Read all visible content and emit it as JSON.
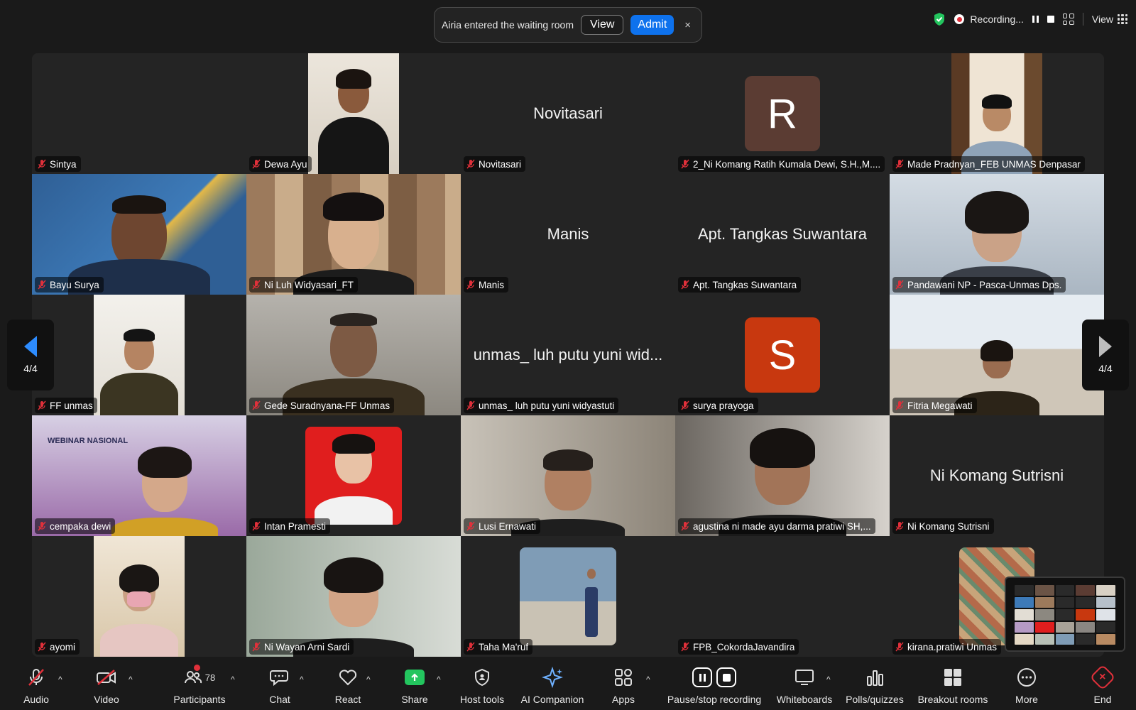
{
  "notification": {
    "message": "Airia entered the waiting room",
    "view_label": "View",
    "admit_label": "Admit",
    "close_symbol": "×"
  },
  "top_right": {
    "recording_label": "Recording...",
    "view_label": "View",
    "colors": {
      "shield": "#23c55e",
      "record_dot": "#e0303a"
    }
  },
  "pagination": {
    "current": "4/4"
  },
  "tiles": [
    {
      "name": "Sintya",
      "muted": true,
      "type": "empty"
    },
    {
      "name": "Dewa Ayu",
      "muted": true,
      "type": "video"
    },
    {
      "name": "Novitasari",
      "display_name": "Novitasari",
      "muted": true,
      "type": "name"
    },
    {
      "name": "2_Ni Komang Ratih Kumala Dewi, S.H.,M....",
      "muted": true,
      "type": "avatar",
      "initial": "R",
      "avatar_color": "#5b3c33"
    },
    {
      "name": "Made Pradnyan_FEB UNMAS Denpasar",
      "muted": true,
      "type": "video"
    },
    {
      "name": "Bayu Surya",
      "muted": true,
      "type": "video"
    },
    {
      "name": "Ni Luh Widyasari_FT",
      "muted": true,
      "type": "video"
    },
    {
      "name": "Manis",
      "display_name": "Manis",
      "muted": true,
      "type": "name"
    },
    {
      "name": "Apt. Tangkas Suwantara",
      "display_name": "Apt. Tangkas Suwantara",
      "muted": true,
      "type": "name"
    },
    {
      "name": "Pandawani NP - Pasca-Unmas Dps.",
      "muted": true,
      "type": "video"
    },
    {
      "name": "FF unmas",
      "muted": true,
      "type": "video"
    },
    {
      "name": "Gede Suradnyana-FF Unmas",
      "muted": true,
      "type": "video"
    },
    {
      "name": "unmas_ luh putu yuni widyastuti",
      "display_name": "unmas_ luh putu yuni wid...",
      "muted": true,
      "type": "name"
    },
    {
      "name": "surya prayoga",
      "muted": true,
      "type": "avatar",
      "initial": "S",
      "avatar_color": "#c8380f"
    },
    {
      "name": "Fitria Megawati",
      "muted": true,
      "type": "video"
    },
    {
      "name": "cempaka dewi",
      "muted": true,
      "type": "video",
      "banner_title": "WEBINAR NASIONAL"
    },
    {
      "name": "Intan Pramesti",
      "muted": true,
      "type": "video"
    },
    {
      "name": "Lusi Ernawati",
      "muted": true,
      "type": "video"
    },
    {
      "name": "agustina ni made ayu darma pratiwi SH,...",
      "muted": true,
      "type": "video"
    },
    {
      "name": "Ni Komang Sutrisni",
      "display_name": "Ni Komang Sutrisni",
      "muted": true,
      "type": "name"
    },
    {
      "name": "ayomi",
      "muted": true,
      "type": "video"
    },
    {
      "name": "Ni Wayan Arni Sardi",
      "muted": true,
      "type": "video"
    },
    {
      "name": "Taha Ma'ruf",
      "muted": true,
      "type": "video"
    },
    {
      "name": "FPB_CokordaJavandira",
      "muted": true,
      "type": "empty"
    },
    {
      "name": "kirana.pratiwi Unmas",
      "muted": true,
      "type": "video"
    }
  ],
  "toolbar": {
    "audio": "Audio",
    "video": "Video",
    "participants": "Participants",
    "participants_count": "78",
    "chat": "Chat",
    "react": "React",
    "share": "Share",
    "host_tools": "Host tools",
    "ai_companion": "AI Companion",
    "apps": "Apps",
    "pause_stop_recording": "Pause/stop recording",
    "whiteboards": "Whiteboards",
    "polls_quizzes": "Polls/quizzes",
    "breakout_rooms": "Breakout rooms",
    "more": "More",
    "end": "End",
    "colors": {
      "share": "#23c55e",
      "end": "#e0303a",
      "admit": "#0e72ed"
    }
  }
}
